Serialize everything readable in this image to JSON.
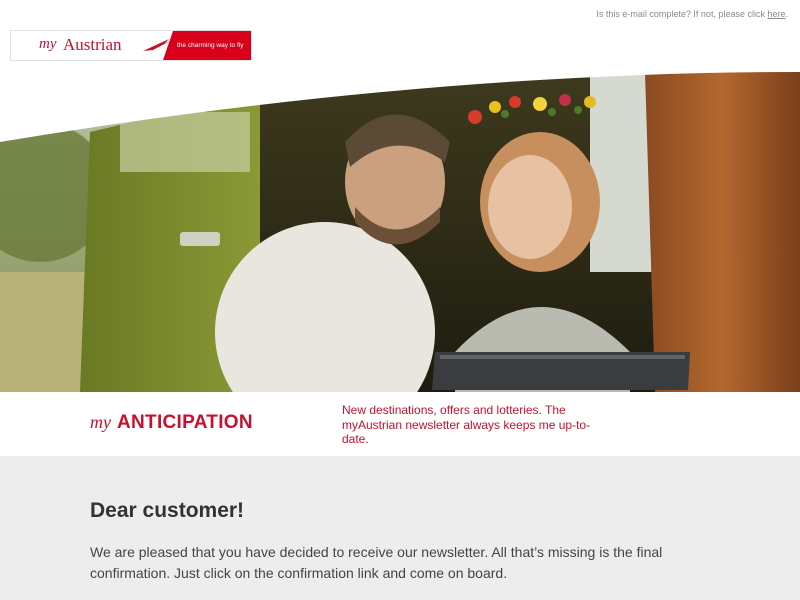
{
  "notice": {
    "text": "Is this e-mail complete? If not, please click ",
    "link": "here",
    "end": "."
  },
  "logo": {
    "my": "my",
    "name": "Austrian",
    "slogan": "the charming way to fly"
  },
  "hero": {
    "image": "couple-in-van-photo"
  },
  "band": {
    "brand_prefix": "my",
    "brand_word": "ANTICIPATION",
    "tagline": "New destinations, offers and lotteries. The myAustrian newsletter always keeps me up-to-date."
  },
  "content": {
    "heading": "Dear customer!",
    "body": "We are pleased that you have decided to receive our newsletter. All that’s missing is the final confirmation. Just click on the confirmation link and come on board."
  },
  "colors": {
    "brand_red": "#c8102e",
    "content_bg": "#ededed"
  }
}
